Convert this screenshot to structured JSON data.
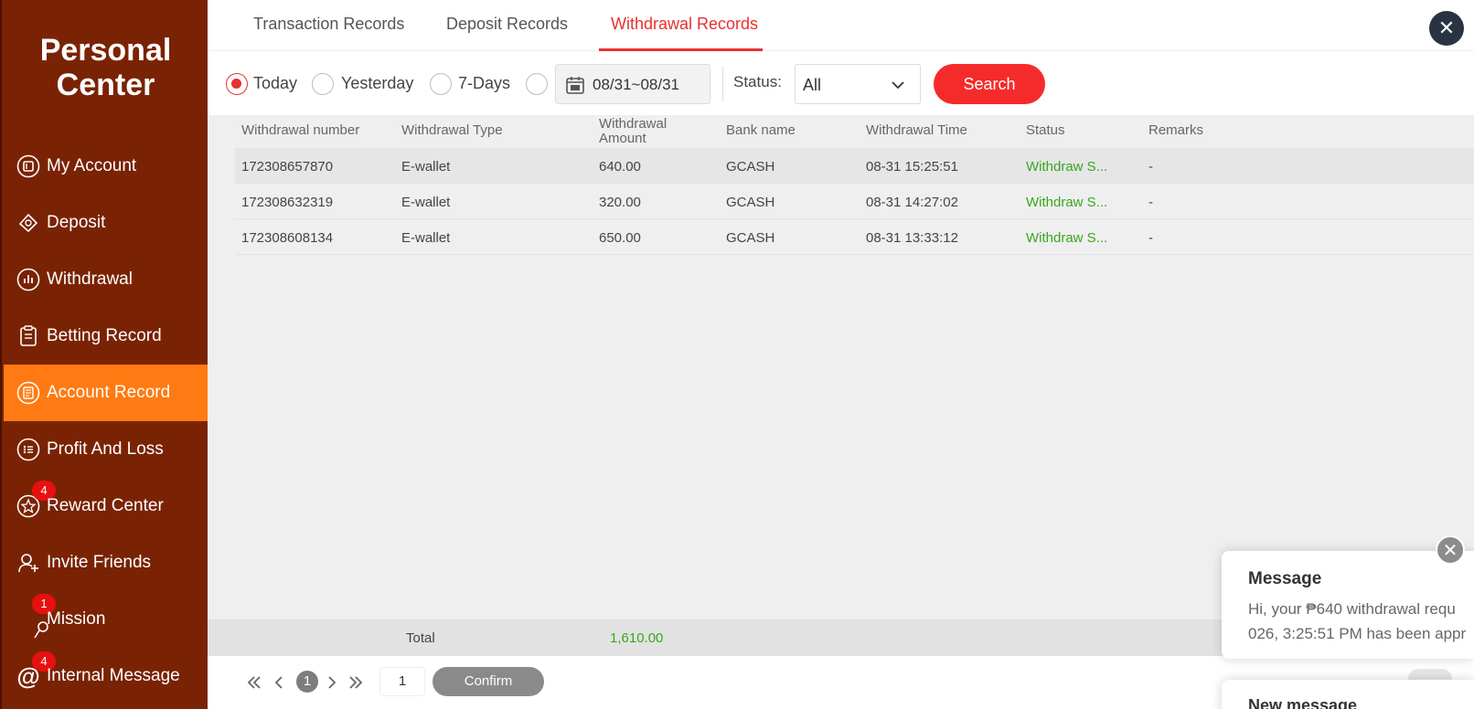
{
  "sidebar": {
    "title_line1": "Personal",
    "title_line2": "Center",
    "items": [
      {
        "label": "My Account",
        "icon": "wallet-icon"
      },
      {
        "label": "Deposit",
        "icon": "deposit-icon"
      },
      {
        "label": "Withdrawal",
        "icon": "withdrawal-icon"
      },
      {
        "label": "Betting Record",
        "icon": "clipboard-icon"
      },
      {
        "label": "Account Record",
        "icon": "record-icon",
        "active": true
      },
      {
        "label": "Profit And Loss",
        "icon": "list-icon"
      },
      {
        "label": "Reward Center",
        "icon": "star-icon",
        "badge": "4"
      },
      {
        "label": "Invite Friends",
        "icon": "invite-icon"
      },
      {
        "label": "Mission",
        "icon": "mission-icon",
        "badge": "1"
      },
      {
        "label": "Internal Message",
        "icon": "at-icon",
        "badge": "4"
      }
    ]
  },
  "tabs": [
    "Transaction Records",
    "Deposit Records",
    "Withdrawal Records"
  ],
  "active_tab": "Withdrawal Records",
  "filter": {
    "options": [
      "Today",
      "Yesterday",
      "7-Days"
    ],
    "selected": "Today",
    "date_range": "08/31~08/31",
    "status_label": "Status:",
    "status_value": "All",
    "search_label": "Search"
  },
  "table": {
    "headers": [
      "Withdrawal number",
      "Withdrawal Type",
      "Withdrawal",
      "Amount",
      "Bank name",
      "Withdrawal Time",
      "Status",
      "Remarks"
    ],
    "rows": [
      [
        "172308657870",
        "E-wallet",
        "640.00",
        "GCASH",
        "08-31 15:25:51",
        "Withdraw S...",
        "-"
      ],
      [
        "172308632319",
        "E-wallet",
        "320.00",
        "GCASH",
        "08-31 14:27:02",
        "Withdraw S...",
        "-"
      ],
      [
        "172308608134",
        "E-wallet",
        "650.00",
        "GCASH",
        "08-31 13:33:12",
        "Withdraw S...",
        "-"
      ]
    ],
    "total_label": "Total",
    "total_value": "1,610.00"
  },
  "pager": {
    "current": "1",
    "input_value": "1",
    "confirm_label": "Confirm"
  },
  "message": {
    "title": "Message",
    "line1": "Hi, your ₱640 withdrawal requ",
    "line2": "026, 3:25:51 PM has been appr",
    "second_title": "New message"
  },
  "colors": {
    "sidebar": "#7a2304",
    "active": "#ff7a12",
    "accent": "#e8302f",
    "success": "#39a620"
  }
}
